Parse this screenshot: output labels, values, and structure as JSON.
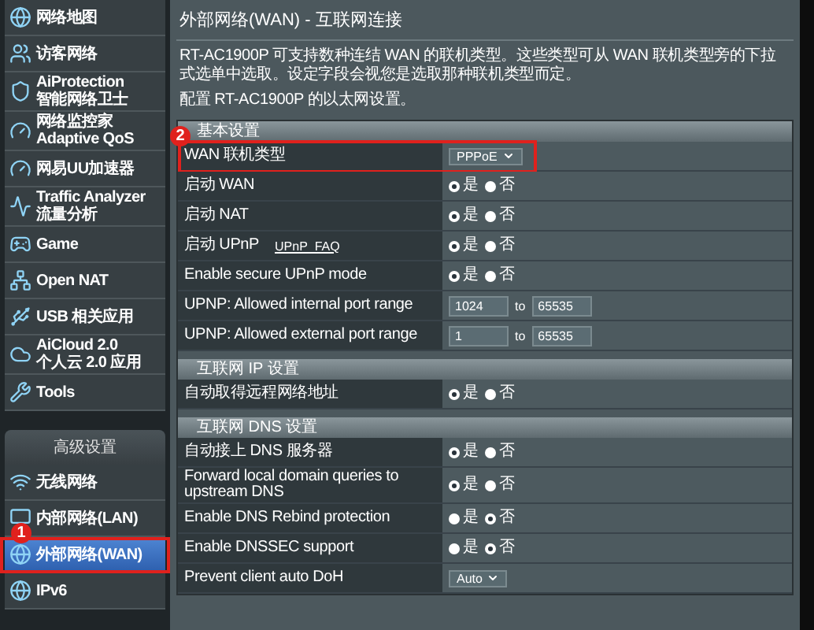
{
  "sidebar": {
    "items": [
      {
        "label": "网络地图",
        "selected": false
      },
      {
        "label": "访客网络",
        "selected": false
      },
      {
        "label": "AiProtection",
        "sublabel": "智能网络卫士",
        "selected": false
      },
      {
        "label": "网络监控家 Adaptive QoS",
        "selected": false
      },
      {
        "label": "网易UU加速器",
        "selected": false
      },
      {
        "label": "Traffic Analyzer",
        "sublabel": "流量分析",
        "selected": false
      },
      {
        "label": "Game",
        "selected": false
      },
      {
        "label": "Open NAT",
        "selected": false
      },
      {
        "label": "USB 相关应用",
        "selected": false
      },
      {
        "label": "AiCloud 2.0",
        "sublabel": "个人云 2.0 应用",
        "selected": false
      },
      {
        "label": "Tools",
        "selected": false
      }
    ],
    "section_header": "高级设置",
    "advanced_items": [
      {
        "label": "无线网络",
        "selected": false
      },
      {
        "label": "内部网络(LAN)",
        "selected": false
      },
      {
        "label": "外部网络(WAN)",
        "selected": true,
        "badge": "1"
      },
      {
        "label": "IPv6",
        "selected": false
      }
    ]
  },
  "main": {
    "title": "外部网络(WAN) - 互联网连接",
    "description": "RT-AC1900P 可支持数种连结 WAN 的联机类型。这些类型可从 WAN 联机类型旁的下拉式选单中选取。设定字段会视您是选取那种联机类型而定。",
    "config_note": "配置 RT-AC1900P 的以太网设置。",
    "sections": [
      {
        "title": "基本设置",
        "rows": [
          {
            "label": "WAN 联机类型",
            "kind": "select",
            "value": "PPPoE",
            "badge": "2"
          },
          {
            "label": "启动 WAN",
            "kind": "radio",
            "options": [
              {
                "label": "是",
                "selected": true
              },
              {
                "label": "否",
                "selected": false
              }
            ]
          },
          {
            "label": "启动 NAT",
            "kind": "radio",
            "options": [
              {
                "label": "是",
                "selected": true
              },
              {
                "label": "否",
                "selected": false
              }
            ]
          },
          {
            "label": "启动 UPnP",
            "link": "UPnP_FAQ",
            "kind": "radio",
            "options": [
              {
                "label": "是",
                "selected": true
              },
              {
                "label": "否",
                "selected": false
              }
            ]
          },
          {
            "label": "Enable secure UPnP mode",
            "kind": "radio",
            "options": [
              {
                "label": "是",
                "selected": true
              },
              {
                "label": "否",
                "selected": false
              }
            ]
          },
          {
            "label": "UPNP: Allowed internal port range",
            "kind": "range",
            "from": "1024",
            "separator": "to",
            "to": "65535"
          },
          {
            "label": "UPNP: Allowed external port range",
            "kind": "range",
            "from": "1",
            "separator": "to",
            "to": "65535"
          }
        ]
      },
      {
        "title": "互联网 IP 设置",
        "rows": [
          {
            "label": "自动取得远程网络地址",
            "kind": "radio",
            "options": [
              {
                "label": "是",
                "selected": true
              },
              {
                "label": "否",
                "selected": false
              }
            ]
          }
        ]
      },
      {
        "title": "互联网 DNS 设置",
        "rows": [
          {
            "label": "自动接上 DNS 服务器",
            "kind": "radio",
            "options": [
              {
                "label": "是",
                "selected": true
              },
              {
                "label": "否",
                "selected": false
              }
            ]
          },
          {
            "label": "Forward local domain queries to upstream DNS",
            "kind": "radio",
            "options": [
              {
                "label": "是",
                "selected": true
              },
              {
                "label": "否",
                "selected": false
              }
            ]
          },
          {
            "label": "Enable DNS Rebind protection",
            "kind": "radio",
            "options": [
              {
                "label": "是",
                "selected": false
              },
              {
                "label": "否",
                "selected": true
              }
            ]
          },
          {
            "label": "Enable DNSSEC support",
            "kind": "radio",
            "options": [
              {
                "label": "是",
                "selected": false
              },
              {
                "label": "否",
                "selected": true
              }
            ]
          },
          {
            "label": "Prevent client auto DoH",
            "kind": "select",
            "value": "Auto"
          }
        ]
      }
    ]
  }
}
